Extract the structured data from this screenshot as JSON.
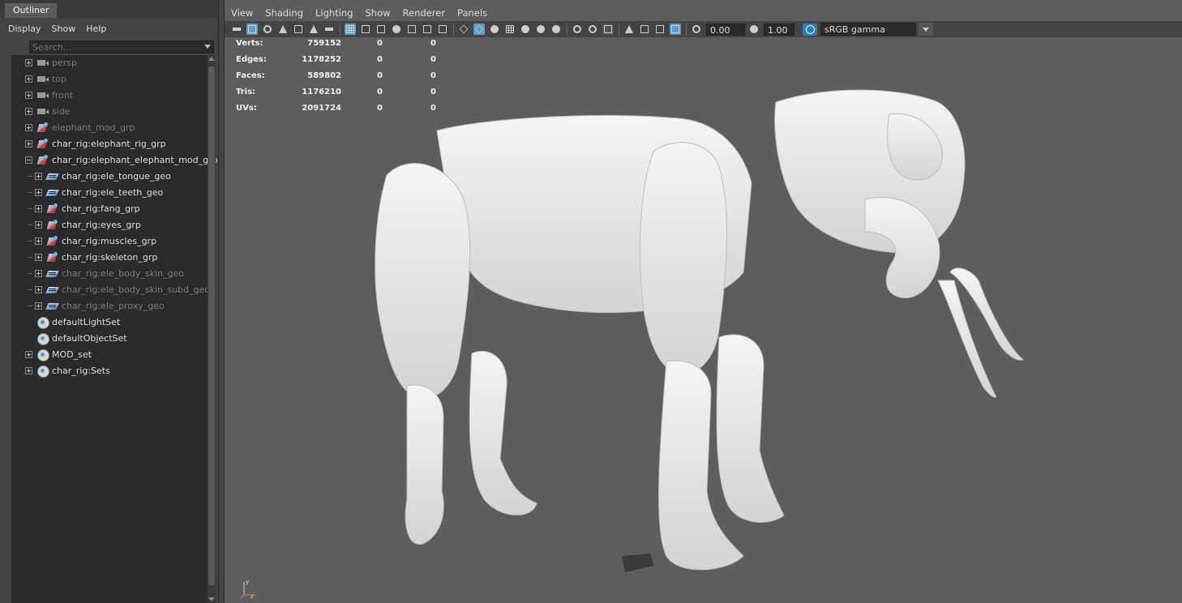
{
  "outliner": {
    "tab_label": "Outliner",
    "menu": [
      "Display",
      "Show",
      "Help"
    ],
    "search_placeholder": "Search...",
    "items": [
      {
        "label": "persp",
        "icon": "camera-icon",
        "depth": 0,
        "dim": true,
        "expander": "plus"
      },
      {
        "label": "top",
        "icon": "camera-icon",
        "depth": 0,
        "dim": true,
        "expander": "plus"
      },
      {
        "label": "front",
        "icon": "camera-icon",
        "depth": 0,
        "dim": true,
        "expander": "plus"
      },
      {
        "label": "side",
        "icon": "camera-icon",
        "depth": 0,
        "dim": true,
        "expander": "plus"
      },
      {
        "label": "elephant_mod_grp",
        "icon": "group-icon",
        "depth": 0,
        "dim": true,
        "expander": "plus"
      },
      {
        "label": "char_rig:elephant_rig_grp",
        "icon": "group-icon",
        "depth": 0,
        "dim": false,
        "expander": "plus"
      },
      {
        "label": "char_rig:elephant_elephant_mod_grp",
        "icon": "group-icon",
        "depth": 0,
        "dim": false,
        "expander": "minus"
      },
      {
        "label": "char_rig:ele_tongue_geo",
        "icon": "mesh-icon",
        "depth": 1,
        "dim": false,
        "expander": "plus"
      },
      {
        "label": "char_rig:ele_teeth_geo",
        "icon": "mesh-icon",
        "depth": 1,
        "dim": false,
        "expander": "plus"
      },
      {
        "label": "char_rig:fang_grp",
        "icon": "group-icon",
        "depth": 1,
        "dim": false,
        "expander": "plus"
      },
      {
        "label": "char_rig:eyes_grp",
        "icon": "group-icon",
        "depth": 1,
        "dim": false,
        "expander": "plus"
      },
      {
        "label": "char_rig:muscles_grp",
        "icon": "group-icon",
        "depth": 1,
        "dim": false,
        "expander": "plus"
      },
      {
        "label": "char_rig:skeleton_grp",
        "icon": "group-icon",
        "depth": 1,
        "dim": false,
        "expander": "plus"
      },
      {
        "label": "char_rig:ele_body_skin_geo",
        "icon": "mesh-icon",
        "depth": 1,
        "dim": true,
        "expander": "plus"
      },
      {
        "label": "char_rig:ele_body_skin_subd_geo",
        "icon": "mesh-icon",
        "depth": 1,
        "dim": true,
        "expander": "plus"
      },
      {
        "label": "char_rig:ele_proxy_geo",
        "icon": "mesh-icon",
        "depth": 1,
        "dim": true,
        "expander": "plus"
      },
      {
        "label": "defaultLightSet",
        "icon": "set-icon",
        "depth": 0,
        "dim": false,
        "expander": "none"
      },
      {
        "label": "defaultObjectSet",
        "icon": "set-icon",
        "depth": 0,
        "dim": false,
        "expander": "none"
      },
      {
        "label": "MOD_set",
        "icon": "set-icon",
        "depth": 0,
        "dim": false,
        "expander": "plus"
      },
      {
        "label": "char_rig:Sets",
        "icon": "set-icon",
        "depth": 0,
        "dim": false,
        "expander": "plus"
      }
    ]
  },
  "viewport": {
    "menu": [
      "View",
      "Shading",
      "Lighting",
      "Show",
      "Renderer",
      "Panels"
    ],
    "exposure": "0.00",
    "gamma": "1.00",
    "colorspace": "sRGB gamma",
    "hud": [
      {
        "label": "Verts:",
        "v1": "759152",
        "v2": "0",
        "v3": "0"
      },
      {
        "label": "Edges:",
        "v1": "1178252",
        "v2": "0",
        "v3": "0"
      },
      {
        "label": "Faces:",
        "v1": "589802",
        "v2": "0",
        "v3": "0"
      },
      {
        "label": "Tris:",
        "v1": "1176210",
        "v2": "0",
        "v3": "0"
      },
      {
        "label": "UVs:",
        "v1": "2091724",
        "v2": "0",
        "v3": "0"
      }
    ],
    "axis_labels": {
      "x": "x",
      "y": "y",
      "z": "z"
    },
    "colors": {
      "background": "#5d5d5d",
      "model": "#e8e8e8",
      "accent": "#5f9ec8"
    }
  }
}
